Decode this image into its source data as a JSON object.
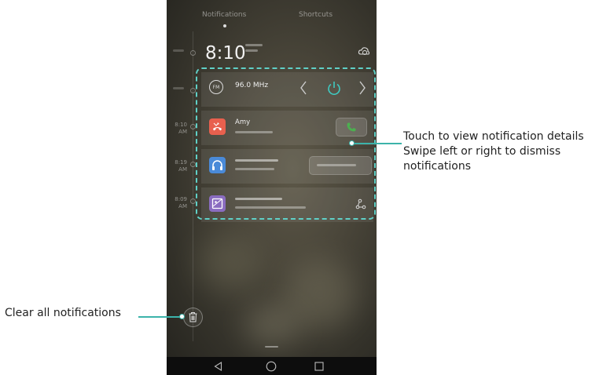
{
  "tabs": [
    {
      "label": "Notifications",
      "active": true
    },
    {
      "label": "Shortcuts",
      "active": false
    }
  ],
  "clock": {
    "time": "8:10"
  },
  "fm": {
    "frequency": "96.0 MHz"
  },
  "notifications": [
    {
      "title": "Amy",
      "app": "phone",
      "color": "#e8604e"
    },
    {
      "app": "headset",
      "color": "#4a8ad8"
    },
    {
      "app": "screenshot",
      "color": "#8a6cc0"
    }
  ],
  "timeline_times": [
    "8:10\nAM",
    "8:19\nAM",
    "8:09\nAM"
  ],
  "callouts": {
    "details_line1": "Touch to view notification details",
    "details_line2": "Swipe left or right to dismiss",
    "details_line3": "notifications",
    "clear_all": "Clear all notifications"
  },
  "colors": {
    "accent": "#5fd0c7",
    "leader": "#3cb3aa",
    "call_green": "#4caf50",
    "power_teal": "#3fc9c0"
  },
  "icons": [
    "cloud-icon",
    "fm-radio-icon",
    "chevron-left-icon",
    "power-icon",
    "chevron-right-icon",
    "missed-call-icon",
    "answer-call-icon",
    "headset-icon",
    "screenshot-icon",
    "share-icon",
    "trash-icon",
    "back-icon",
    "home-icon",
    "recents-icon"
  ]
}
